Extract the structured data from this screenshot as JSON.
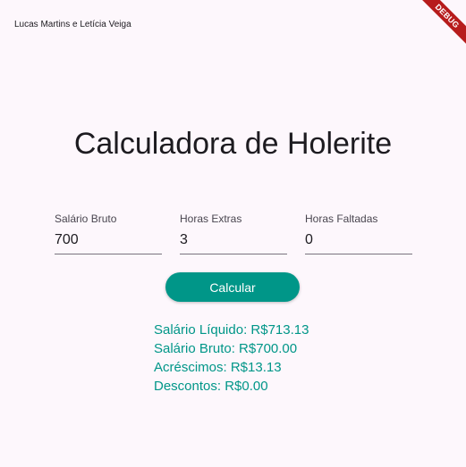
{
  "appbar": {
    "title": "Lucas Martins e Letícia Veiga"
  },
  "debug_banner": {
    "label": "DEBUG"
  },
  "main": {
    "title": "Calculadora de Holerite",
    "fields": {
      "salario_bruto": {
        "label": "Salário Bruto",
        "value": "700"
      },
      "horas_extras": {
        "label": "Horas Extras",
        "value": "3"
      },
      "horas_faltadas": {
        "label": "Horas Faltadas",
        "value": "0"
      }
    },
    "calculate_button": "Calcular",
    "results": {
      "salario_liquido": "Salário Líquido: R$713.13",
      "salario_bruto": "Salário Bruto: R$700.00",
      "acrescimos": "Acréscimos: R$13.13",
      "descontos": "Descontos: R$0.00"
    }
  },
  "colors": {
    "background": "#fdf7fc",
    "accent": "#009688",
    "debug_banner": "#b71c1c"
  }
}
